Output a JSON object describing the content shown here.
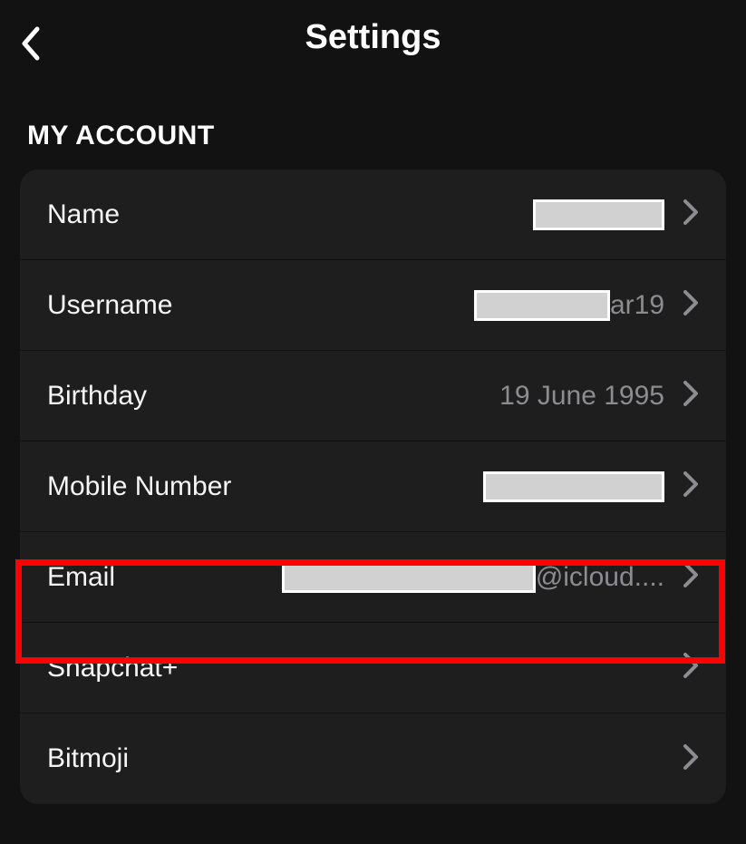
{
  "header": {
    "title": "Settings"
  },
  "section": {
    "title": "MY ACCOUNT"
  },
  "rows": {
    "name": {
      "label": "Name",
      "value": ""
    },
    "username": {
      "label": "Username",
      "suffix": "ar19"
    },
    "birthday": {
      "label": "Birthday",
      "value": "19 June 1995"
    },
    "mobile": {
      "label": "Mobile Number",
      "value": ""
    },
    "email": {
      "label": "Email",
      "suffix": "@icloud...."
    },
    "snapchatplus": {
      "label": "Snapchat+"
    },
    "bitmoji": {
      "label": "Bitmoji"
    }
  }
}
